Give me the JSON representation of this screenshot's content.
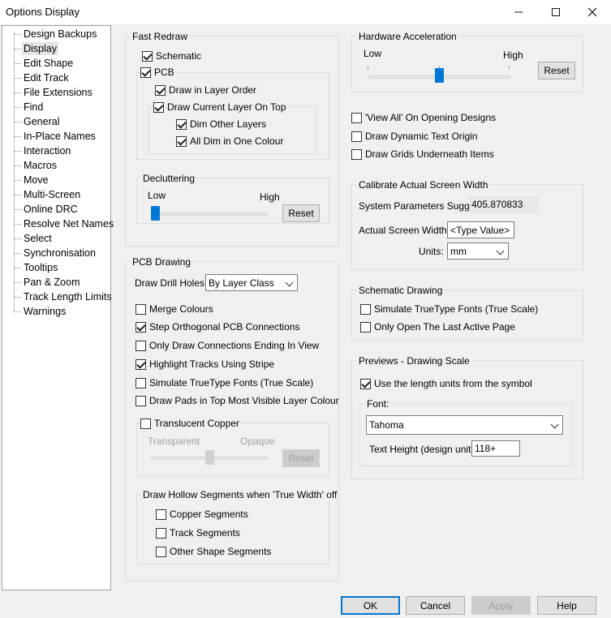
{
  "window": {
    "title": "Options  Display"
  },
  "tree": {
    "items": [
      "Design Backups",
      "Display",
      "Edit Shape",
      "Edit Track",
      "File Extensions",
      "Find",
      "General",
      "In-Place Names",
      "Interaction",
      "Macros",
      "Move",
      "Multi-Screen",
      "Online DRC",
      "Resolve Net Names",
      "Select",
      "Synchronisation",
      "Tooltips",
      "Pan & Zoom",
      "Track Length Limits",
      "Warnings"
    ],
    "selected": "Display"
  },
  "fast_redraw": {
    "title": "Fast Redraw",
    "schematic": "Schematic",
    "pcb": "PCB",
    "draw_in_layer_order": "Draw in Layer Order",
    "draw_current_layer": "Draw Current Layer On Top",
    "dim_other_layers": "Dim Other Layers",
    "all_dim_one_colour": "All Dim in One Colour"
  },
  "decluttering": {
    "title": "Decluttering",
    "low": "Low",
    "high": "High",
    "reset": "Reset",
    "level": 0.0
  },
  "pcb_drawing": {
    "title": "PCB Drawing",
    "drill_holes_label": "Draw Drill Holes:",
    "drill_holes_value": "By Layer Class",
    "merge_colours": "Merge Colours",
    "step_orthogonal": "Step Orthogonal PCB Connections",
    "only_draw_connections": "Only Draw Connections Ending In View",
    "highlight_tracks": "Highlight Tracks Using Stripe",
    "simulate_truetype": "Simulate TrueType Fonts (True Scale)",
    "draw_pads": "Draw Pads in Top Most Visible Layer Colour",
    "translucent_copper": "Translucent Copper",
    "transparent": "Transparent",
    "opaque": "Opaque",
    "reset": "Reset",
    "translucency_level": 0.5
  },
  "hollow": {
    "title": "Draw Hollow Segments when 'True Width' off",
    "copper": "Copper Segments",
    "track": "Track Segments",
    "other": "Other Shape Segments"
  },
  "hardware": {
    "title": "Hardware Acceleration",
    "low": "Low",
    "high": "High",
    "reset": "Reset",
    "level": 0.5
  },
  "misc": {
    "view_all": "'View All' On Opening Designs",
    "dynamic_text": "Draw Dynamic Text Origin",
    "grids_underneath": "Draw Grids Underneath Items"
  },
  "calibrate": {
    "title": "Calibrate Actual Screen Width",
    "suggest_label": "System Parameters Suggest:",
    "suggest_value": "405.870833",
    "actual_label": "Actual Screen Width:",
    "actual_value": "<Type Value>",
    "units_label": "Units:",
    "units_value": "mm"
  },
  "schematic_drawing": {
    "title": "Schematic Drawing",
    "simulate_truetype": "Simulate TrueType Fonts (True Scale)",
    "only_open_last": "Only Open The Last Active Page"
  },
  "previews": {
    "title": "Previews - Drawing Scale",
    "use_length_units": "Use the length units from the symbol",
    "font_title": "Font:",
    "font_value": "Tahoma",
    "text_height_label": "Text Height (design units):",
    "text_height_value": "118+"
  },
  "footer": {
    "ok": "OK",
    "cancel": "Cancel",
    "apply": "Apply",
    "help": "Help"
  },
  "colors": {
    "accent": "#0078d7",
    "window_bg": "#f0f0f0"
  }
}
